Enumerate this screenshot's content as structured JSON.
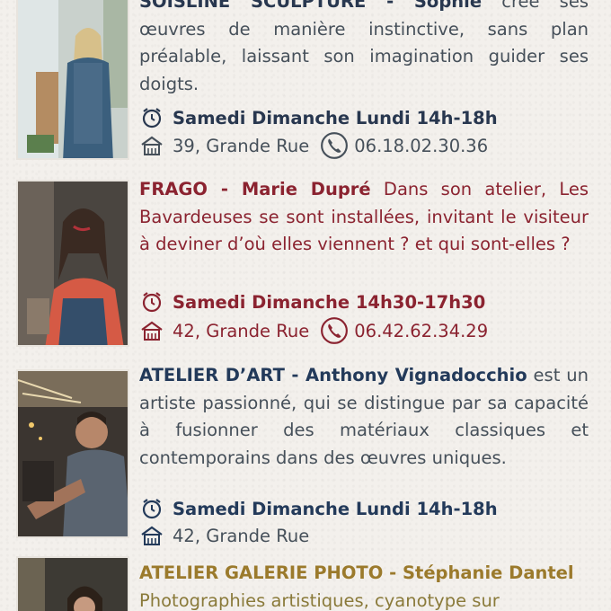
{
  "entries": [
    {
      "lead": "SOISLINE SCULPTURE - Sophie",
      "body": " crée ses œuvres de manière instinctive, sans plan préalable, laissant son imagination guider ses doigts.",
      "schedule": "Samedi Dimanche Lundi 14h-18h",
      "address": "39, Grande Rue",
      "phone": "06.18.02.30.36"
    },
    {
      "lead": "FRAGO - Marie Dupré",
      "body": " Dans son atelier, Les Bavardeuses se sont installées, invitant le visiteur à deviner d’où elles viennent ? et qui sont-elles ?",
      "schedule": "Samedi Dimanche 14h30-17h30",
      "address": "42, Grande Rue",
      "phone": "06.42.62.34.29"
    },
    {
      "lead": "ATELIER D’ART - Anthony Vignadocchio",
      "body": " est un artiste passionné, qui se distingue par sa capacité à fusionner des matériaux classiques et contemporains dans des œuvres uniques.",
      "schedule": "Samedi Dimanche Lundi 14h-18h",
      "address": "42, Grande Rue"
    },
    {
      "lead": "ATELIER GALERIE PHOTO - Stéphanie Dantel",
      "body": "Photographies artistiques, cyanotype sur"
    }
  ],
  "icons": {
    "clock": "alarm-clock-icon",
    "house": "house-icon",
    "phone": "phone-icon"
  },
  "colors": {
    "slate": "#28374f",
    "burgundy": "#8b2330",
    "navy": "#233a5a",
    "ochre": "#9b7a2c"
  }
}
